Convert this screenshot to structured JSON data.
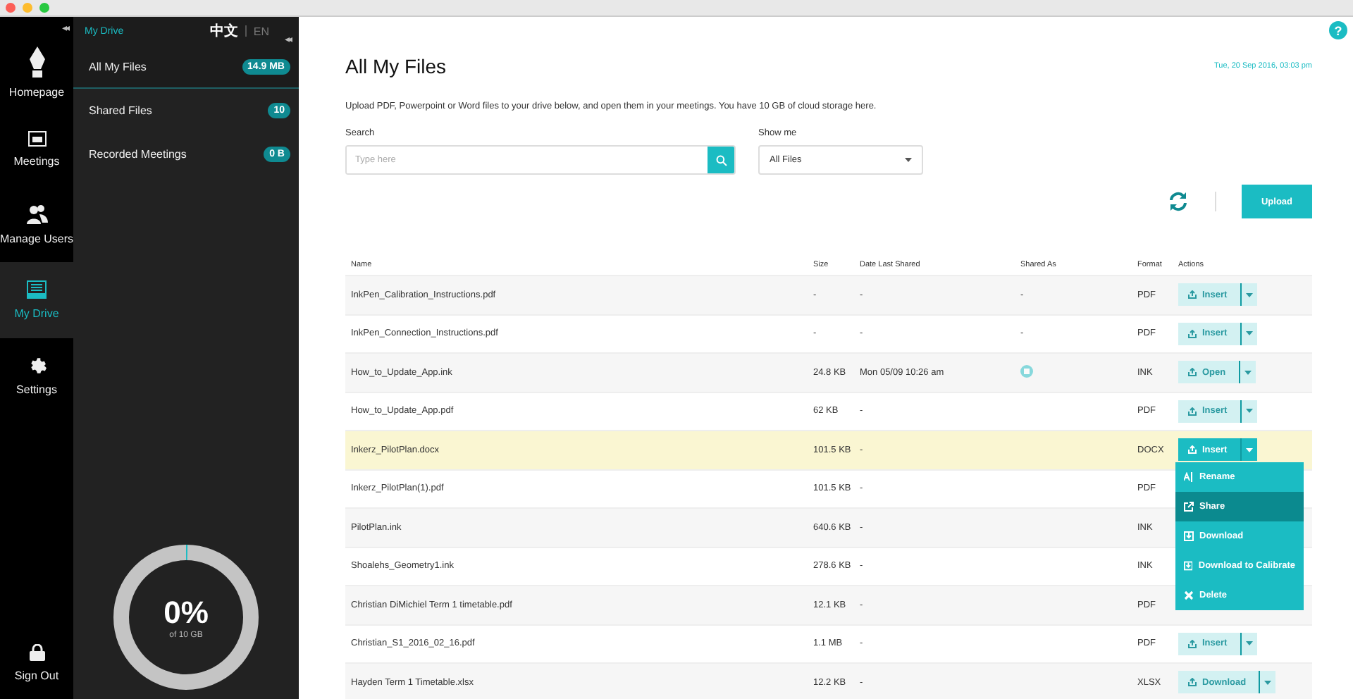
{
  "rail": {
    "collapse": "◂◂",
    "items": [
      {
        "kind": "pen",
        "label": "Homepage",
        "selected": false
      },
      {
        "kind": "calendar",
        "label": "Meetings",
        "selected": false
      },
      {
        "kind": "users",
        "label": "Manage Users",
        "selected": false
      },
      {
        "kind": "drive",
        "label": "My Drive",
        "selected": true
      },
      {
        "kind": "gear",
        "label": "Settings",
        "selected": false
      }
    ],
    "signout": "Sign Out"
  },
  "panel": {
    "title": "My Drive",
    "languages": [
      {
        "label": "中文",
        "selected": true
      },
      {
        "label": "EN",
        "selected": false
      }
    ],
    "collapse": "◂◂",
    "items": [
      {
        "label": "All My Files",
        "badge": "14.9 MB",
        "selected": true
      },
      {
        "label": "Shared Files",
        "badge": "10",
        "selected": false
      },
      {
        "label": "Recorded Meetings",
        "badge": "0 B",
        "selected": false
      }
    ],
    "storage": {
      "level": 0,
      "percent": "0%",
      "caption": "of 10 GB"
    }
  },
  "main": {
    "title": "All My Files",
    "datetime": "Tue, 20 Sep 2016, 03:03 pm",
    "help": "?",
    "intro": "Upload PDF, Powerpoint or Word files to your drive below, and open them in your meetings. You have 10 GB of cloud storage here.",
    "search": {
      "label": "Search",
      "placeholder": "Type here"
    },
    "filter": {
      "label": "Show me",
      "value": "All Files"
    },
    "upload": "Upload",
    "table": {
      "columns": [
        "Name",
        "Size",
        "Date Last Shared",
        "Shared As",
        "Format",
        "Actions"
      ],
      "rows": [
        {
          "name": "InkPen_Calibration_Instructions.pdf",
          "size": "-",
          "date": "-",
          "shared_as": "-",
          "format": "PDF",
          "action": {
            "label": "Insert",
            "active": false
          },
          "selected": false
        },
        {
          "name": "InkPen_Connection_Instructions.pdf",
          "size": "-",
          "date": "-",
          "shared_as": "-",
          "format": "PDF",
          "action": {
            "label": "Insert",
            "active": false
          },
          "selected": false
        },
        {
          "name": "How_to_Update_App.ink",
          "size": "24.8 KB",
          "date": "Mon 05/09 10:26 am",
          "shared_icon": true,
          "format": "INK",
          "action": {
            "label": "Open",
            "active": false
          },
          "selected": false
        },
        {
          "name": "How_to_Update_App.pdf",
          "size": "62 KB",
          "date": "-",
          "format": "PDF",
          "action": {
            "label": "Insert",
            "active": false
          },
          "selected": false
        },
        {
          "name": "Inkerz_PilotPlan.docx",
          "size": "101.5 KB",
          "date": "-",
          "format": "DOCX",
          "action": {
            "label": "Insert",
            "active": true
          },
          "selected": true,
          "menu": [
            {
              "kind": "rename",
              "label": "Rename",
              "selected": false
            },
            {
              "kind": "share",
              "label": "Share",
              "selected": true
            },
            {
              "kind": "download",
              "label": "Download",
              "selected": false
            },
            {
              "kind": "download",
              "label": "Download to Calibrate",
              "selected": false
            },
            {
              "kind": "delete",
              "label": "Delete",
              "selected": false
            }
          ]
        },
        {
          "name": "Inkerz_PilotPlan(1).pdf",
          "size": "101.5 KB",
          "date": "-",
          "format": "PDF",
          "selected": false
        },
        {
          "name": "PilotPlan.ink",
          "size": "640.6 KB",
          "date": "-",
          "format": "INK",
          "selected": false
        },
        {
          "name": "Shoalehs_Geometry1.ink",
          "size": "278.6 KB",
          "date": "-",
          "format": "INK",
          "selected": false
        },
        {
          "name": "Christian DiMichiel Term 1 timetable.pdf",
          "size": "12.1 KB",
          "date": "-",
          "format": "PDF",
          "selected": false
        },
        {
          "name": "Christian_S1_2016_02_16.pdf",
          "size": "1.1 MB",
          "date": "-",
          "format": "PDF",
          "action": {
            "label": "Insert",
            "active": false
          },
          "selected": false
        },
        {
          "name": "Hayden Term 1 Timetable.xlsx",
          "size": "12.2 KB",
          "date": "-",
          "format": "XLSX",
          "action": {
            "label": "Download",
            "active": false
          },
          "selected": false
        }
      ]
    }
  }
}
